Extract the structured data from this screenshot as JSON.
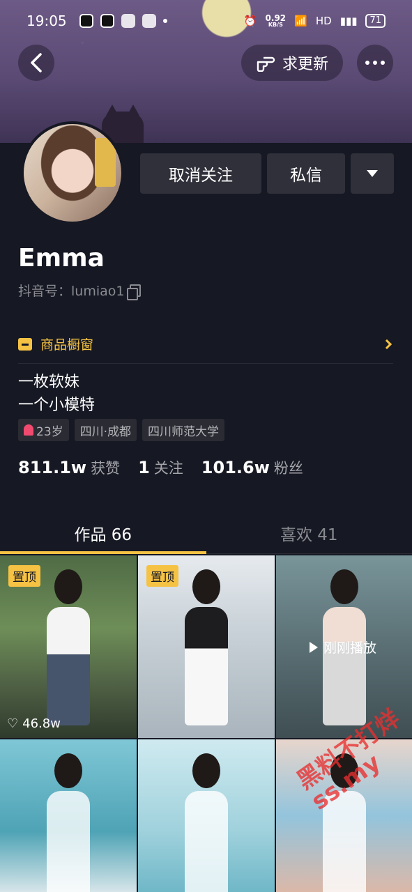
{
  "status_bar": {
    "time": "19:05",
    "speed_value": "0.92",
    "speed_unit": "KB/S",
    "network": "HD",
    "battery": "71"
  },
  "nav": {
    "back_icon": "chevron-left-icon",
    "request_update_label": "求更新",
    "more_icon": "more-icon"
  },
  "profile": {
    "name": "Emma",
    "douyin_id": "抖音号：lumiao1",
    "shop_label": "商品橱窗",
    "bio_lines": [
      "一枚软妹",
      "一个小模特"
    ],
    "tags": {
      "age": "23岁",
      "location": "四川·成都",
      "school": "四川师范大学"
    },
    "stats": {
      "likes_num": "811.1w",
      "likes_label": "获赞",
      "following_num": "1",
      "following_label": "关注",
      "followers_num": "101.6w",
      "followers_label": "粉丝"
    }
  },
  "actions": {
    "unfollow_label": "取消关注",
    "message_label": "私信"
  },
  "tabs": [
    {
      "label": "作品 66",
      "active": true
    },
    {
      "label": "喜欢 41",
      "active": false
    }
  ],
  "grid": {
    "pinned_label": "置顶",
    "likes_first": "46.8w",
    "just_played_label": "刚刚播放"
  },
  "watermark": {
    "line1": "黑料不打烊",
    "line2": "ss.my"
  },
  "colors": {
    "background": "#161823",
    "accent": "#f5c244",
    "button": "#2f3039"
  }
}
